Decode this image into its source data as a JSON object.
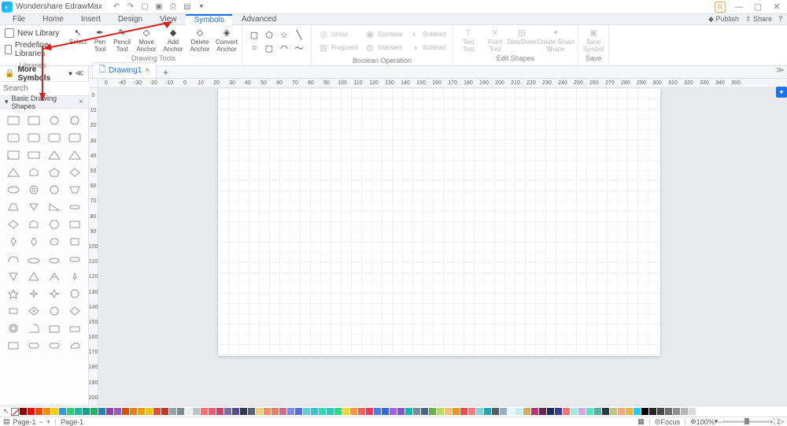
{
  "app_title": "Wondershare EdrawMax",
  "menu_tabs": [
    "File",
    "Home",
    "Insert",
    "Design",
    "View",
    "Symbols",
    "Advanced"
  ],
  "active_menu": "Symbols",
  "top_right": {
    "publish": "Publish",
    "share": "Share"
  },
  "ribbon_left": {
    "new_library": "New Library",
    "predefine_libraries": "Predefine Libraries",
    "libraries_label": "Libraries"
  },
  "drawing_tools": {
    "select": {
      "l1": "Select",
      "l2": ""
    },
    "pen": {
      "l1": "Pen",
      "l2": "Tool"
    },
    "pencil": {
      "l1": "Pencil",
      "l2": "Tool"
    },
    "move_anchor": {
      "l1": "Move",
      "l2": "Anchor"
    },
    "add_anchor": {
      "l1": "Add",
      "l2": "Anchor"
    },
    "delete_anchor": {
      "l1": "Delete",
      "l2": "Anchor"
    },
    "convert_anchor": {
      "l1": "Convert",
      "l2": "Anchor"
    },
    "group_label": "Drawing Tools"
  },
  "boolean_ops": {
    "union": "Union",
    "combine": "Combine",
    "subtract": "Subtract",
    "fragment": "Fragment",
    "intersect": "Intersect",
    "subtract2": "Subtract",
    "group_label": "Boolean Operation"
  },
  "edit_shapes": {
    "text_tool": {
      "l1": "Text",
      "l2": "Tool"
    },
    "point_tool": {
      "l1": "Point",
      "l2": "Tool"
    },
    "datasheet": "DataSheet",
    "create_smart": {
      "l1": "Create Smart",
      "l2": "Shape"
    },
    "group_label": "Edit Shapes"
  },
  "save_group": {
    "save_symbol": {
      "l1": "Save",
      "l2": "Symbol"
    },
    "group_label": "Save"
  },
  "left_panel": {
    "more_symbols": "More Symbols",
    "search_placeholder": "Search",
    "category": "Basic Drawing Shapes"
  },
  "document_tab": "Drawing1",
  "ruler_h": [
    "0",
    "-40",
    "-30",
    "-20",
    "-10",
    "0",
    "10",
    "20",
    "30",
    "40",
    "50",
    "60",
    "70",
    "80",
    "90",
    "100",
    "110",
    "120",
    "130",
    "140",
    "150",
    "160",
    "170",
    "180",
    "190",
    "200",
    "210",
    "220",
    "230",
    "240",
    "250",
    "260",
    "270",
    "280",
    "290",
    "300",
    "310",
    "320",
    "330",
    "340",
    "350"
  ],
  "ruler_v": [
    "0",
    "10",
    "20",
    "30",
    "40",
    "50",
    "60",
    "70",
    "80",
    "90",
    "100",
    "110",
    "120",
    "130",
    "140",
    "150",
    "160",
    "170",
    "180",
    "190",
    "200"
  ],
  "color_swatches": [
    "#8b0000",
    "#ff0000",
    "#ff4400",
    "#ff8800",
    "#ffcc00",
    "#3498db",
    "#2ecc71",
    "#1abc9c",
    "#16a085",
    "#27ae60",
    "#2980b9",
    "#8e44ad",
    "#9b59b6",
    "#d35400",
    "#e67e22",
    "#f39c12",
    "#f1c40f",
    "#e74c3c",
    "#c0392b",
    "#95a5a6",
    "#7f8c8d",
    "#ecf0f1",
    "#bdc3c7",
    "#ff6b6b",
    "#ee5a6f",
    "#c44569",
    "#786fa6",
    "#574b90",
    "#303952",
    "#596275",
    "#f5cd79",
    "#f19066",
    "#e77f67",
    "#cf6a87",
    "#778beb",
    "#546de5",
    "#63cdda",
    "#3dc1d3",
    "#33d9b2",
    "#2bcbba",
    "#26de81",
    "#fed330",
    "#fd9644",
    "#fc5c65",
    "#eb3b5a",
    "#4b7bec",
    "#3867d6",
    "#a55eea",
    "#8854d0",
    "#0fb9b1",
    "#778ca3",
    "#4b6584",
    "#6ab04c",
    "#badc58",
    "#ffbe76",
    "#f0932b",
    "#eb4d4b",
    "#ff7979",
    "#7ed6df",
    "#22a6b3",
    "#535c68",
    "#95afc0",
    "#dff9fb",
    "#c7ecee",
    "#ccae62",
    "#b33771",
    "#6D214F",
    "#182C61",
    "#3B3B98",
    "#FD7272",
    "#9AECDB",
    "#D6A2E8",
    "#55E6C1",
    "#58B19F",
    "#2C3A47",
    "#BDC581",
    "#FEA47F",
    "#EAB543",
    "#25CCF7",
    "#000000",
    "#242424",
    "#484848",
    "#6d6d6d",
    "#919191",
    "#b6b6b6",
    "#dadada",
    "#ffffff"
  ],
  "statusbar": {
    "page_tab": "Page-1",
    "page_label": "Page-1",
    "focus": "Focus",
    "zoom": "100%"
  }
}
